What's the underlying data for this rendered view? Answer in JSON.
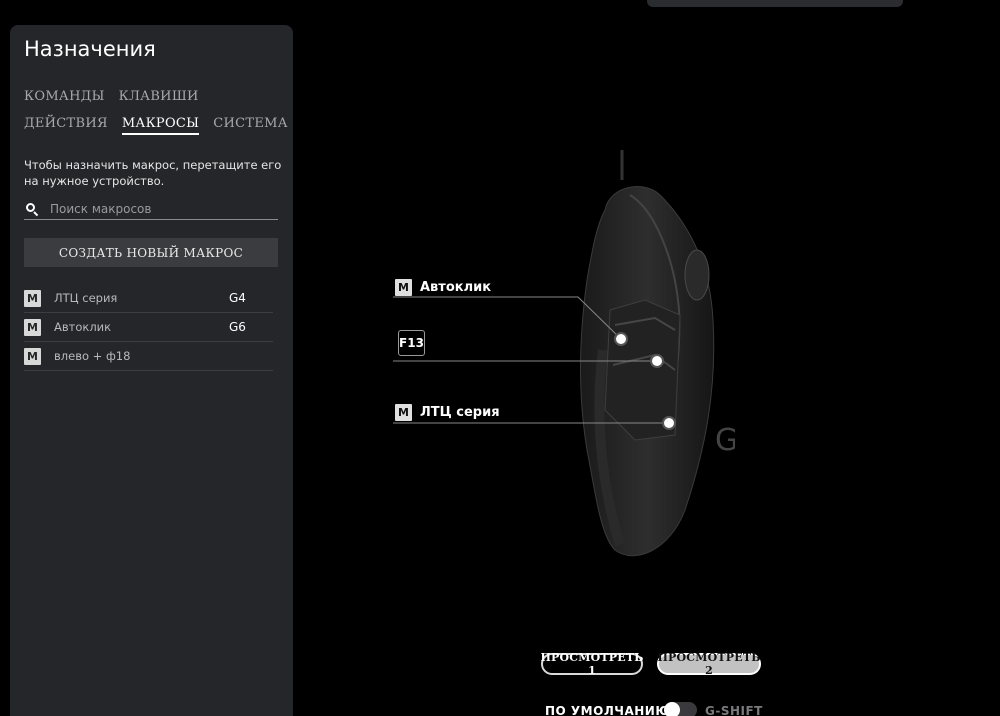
{
  "panel": {
    "title": "Назначения",
    "tabs_row1": [
      "КОМАНДЫ",
      "КЛАВИШИ"
    ],
    "tabs_row2": [
      "ДЕЙСТВИЯ",
      "МАКРОСЫ",
      "СИСТЕМА"
    ],
    "active_tab": "МАКРОСЫ",
    "hint": "Чтобы назначить макрос, перетащите его на нужное устройство.",
    "search": {
      "placeholder": "Поиск макросов",
      "value": ""
    },
    "create_button": "СОЗДАТЬ НОВЫЙ МАКРОС",
    "macros": [
      {
        "badge": "M",
        "name": "ЛТЦ серия",
        "key": "G4"
      },
      {
        "badge": "M",
        "name": "Автоклик",
        "key": "G6"
      },
      {
        "badge": "M",
        "name": "влево + ф18",
        "key": ""
      }
    ]
  },
  "device": {
    "callouts": [
      {
        "badge": "M",
        "label": "Автоклик"
      },
      {
        "chip": "F13"
      },
      {
        "badge": "M",
        "label": "ЛТЦ серия"
      }
    ]
  },
  "view": {
    "view1": "ПРОСМОТРЕТЬ 1",
    "view2": "ПРОСМОТРЕТЬ 2",
    "active": "view2"
  },
  "mode": {
    "default": "ПО УМОЛЧАНИЮ",
    "gshift": "G-SHIFT",
    "gshift_on": false
  },
  "colors": {
    "background": "#000000",
    "panel": "#25262a",
    "button": "#3b3c40"
  }
}
